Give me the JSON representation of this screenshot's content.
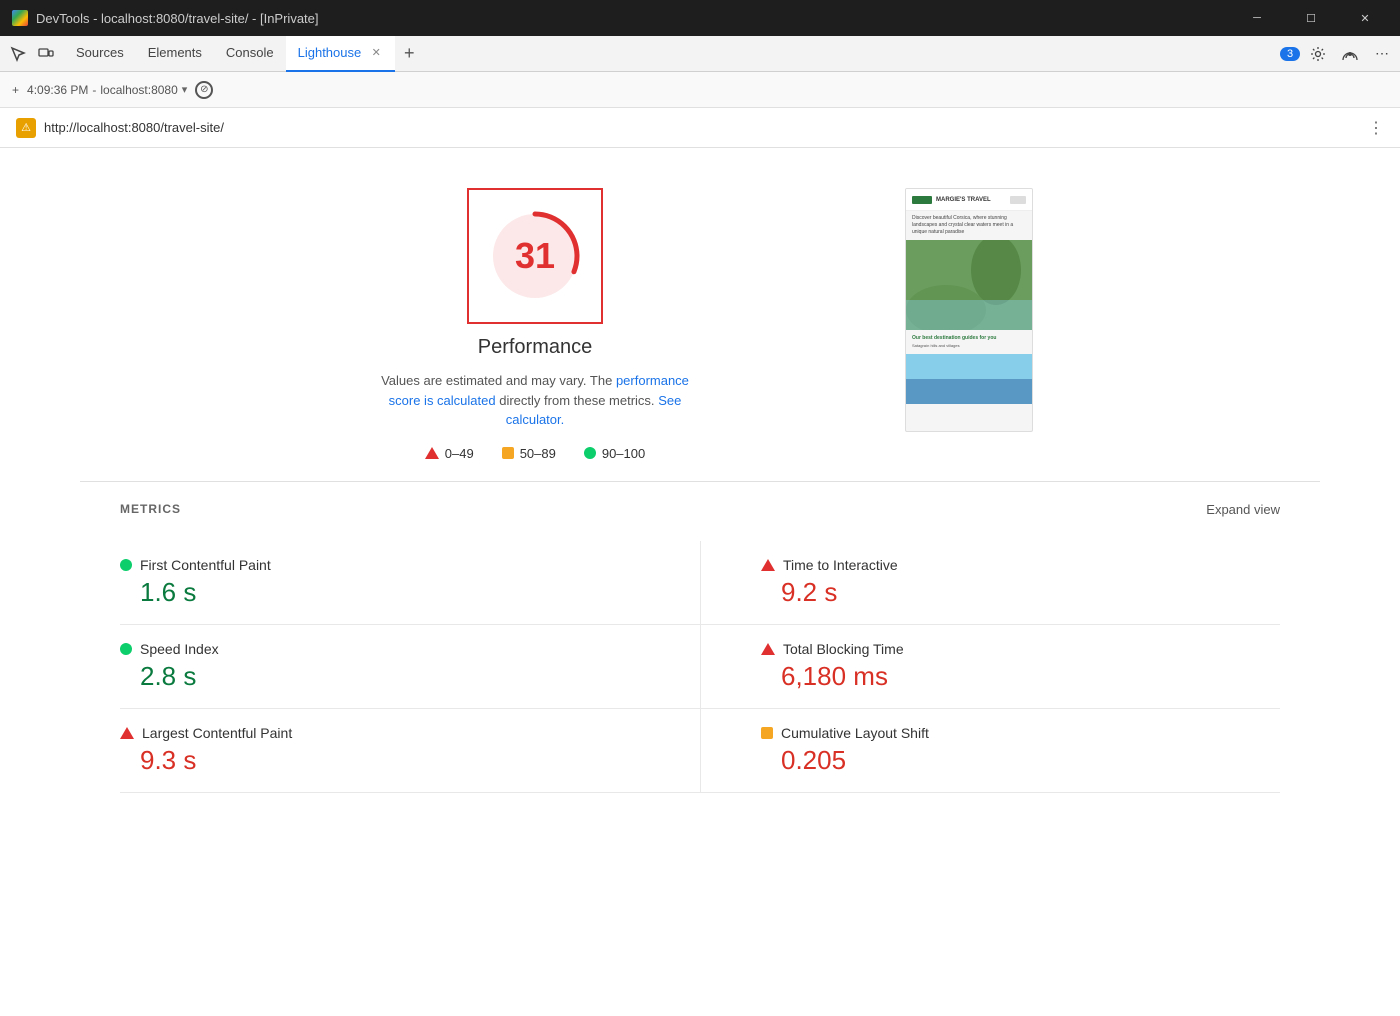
{
  "titleBar": {
    "title": "DevTools - localhost:8080/travel-site/ - [InPrivate]",
    "favicon": "devtools-favicon"
  },
  "tabs": [
    {
      "id": "sources",
      "label": "Sources",
      "active": false,
      "closable": false
    },
    {
      "id": "elements",
      "label": "Elements",
      "active": false,
      "closable": false
    },
    {
      "id": "console",
      "label": "Console",
      "active": false,
      "closable": false
    },
    {
      "id": "lighthouse",
      "label": "Lighthouse",
      "active": true,
      "closable": true
    }
  ],
  "toolbar": {
    "notificationCount": "3",
    "addTabLabel": "+"
  },
  "locationBar": {
    "time": "4:09:36 PM",
    "host": "localhost:8080",
    "dropdownIcon": "▾"
  },
  "urlBar": {
    "url": "http://localhost:8080/travel-site/",
    "moreIcon": "⋮"
  },
  "performance": {
    "score": "31",
    "label": "Performance",
    "description": "Values are estimated and may vary. The",
    "link1Text": "performance score is calculated",
    "description2": "directly from these metrics.",
    "link2Text": "See calculator.",
    "legend": [
      {
        "type": "triangle",
        "range": "0–49"
      },
      {
        "type": "square",
        "range": "50–89"
      },
      {
        "type": "circle",
        "range": "90–100"
      }
    ]
  },
  "screenshot": {
    "headerText": "MARGIE'S TRAVEL",
    "heroText": "Discover beautiful Corsica, where stunning landscapes and crystal clear waters meet in a unique natural paradise",
    "sectionTitle": "Our best destination guides for you",
    "sectionText": "Satagraín hills and villages"
  },
  "metrics": {
    "title": "METRICS",
    "expandLabel": "Expand view",
    "items": [
      {
        "id": "fcp",
        "indicator": "green",
        "name": "First Contentful Paint",
        "value": "1.6 s"
      },
      {
        "id": "tti",
        "indicator": "red",
        "name": "Time to Interactive",
        "value": "9.2 s"
      },
      {
        "id": "si",
        "indicator": "green",
        "name": "Speed Index",
        "value": "2.8 s"
      },
      {
        "id": "tbt",
        "indicator": "red",
        "name": "Total Blocking Time",
        "value": "6,180 ms"
      },
      {
        "id": "lcp",
        "indicator": "red",
        "name": "Largest Contentful Paint",
        "value": "9.3 s"
      },
      {
        "id": "cls",
        "indicator": "orange",
        "name": "Cumulative Layout Shift",
        "value": "0.205"
      }
    ]
  }
}
